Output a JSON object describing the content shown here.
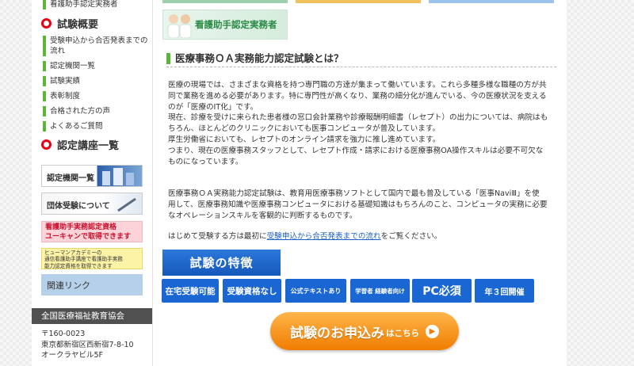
{
  "sidebar": {
    "top_item": "看護助手認定実務者",
    "exam_overview": {
      "title": "試験概要",
      "items": [
        "受験申込から合否発表までの流れ",
        "認定機関一覧",
        "試験実績",
        "表彰制度",
        "合格された方の声",
        "よくあるご質問"
      ]
    },
    "course_list": {
      "title": "認定講座一覧"
    },
    "banners": {
      "accredited": "認定機関一覧",
      "group": "団体受験について",
      "nurse_aide_line1": "看護助手実務認定資格",
      "nurse_aide_line2": "ユーキャンで取得できます",
      "human_line1": "ヒューマンアカデミーの",
      "human_line2": "通信看護助手講座で看護助手実務",
      "human_line3": "能力認定資格を取得できます",
      "related": "関連リンク"
    },
    "org": {
      "name": "全国医療福祉教育協会",
      "postal": "〒160-0023",
      "address1": "東京都新宿区西新宿7-8-10",
      "address2": "オークラヤビル5F"
    }
  },
  "main": {
    "top_banner": "看護助手認定実務者",
    "heading": "医療事務ＯＡ実務能力認定試験とは？",
    "para1": [
      "医療の現場では、さまざまな資格を持つ専門職の方達が集まって働いています。これら多種多様な職種の方が共",
      "同で業務を進める必要があります。特に専門性が高くなり、業務の細分化が進んでいる、今の医療状況を支える",
      "のが「医療のIT化」です。",
      "現在、診療を受けに来られた患者様の窓口会計業務や診療報酬明細書（レセプト）の出力については、病院はも",
      "ちろん、ほとんどのクリニックにおいても医事コンピュータが普及しています。",
      "厚生労働省においても、レセプトのオンライン請求を強力に推し進めています。",
      "つまり、現在の医療事務スタッフとして、レセプト作成・請求における医療事務OA操作スキルは必要不可欠な",
      "ものになっています。"
    ],
    "para2": [
      "医療事務ＯＡ実務能力認定試験は、教育用医療事務ソフトとして国内で最も普及している「医事NaviⅢ」を使",
      "用して、医療事務知識や医療事務コンピュータにおける基礎知識はもちろんのこと、コンピュータの実務に必要",
      "なオペレーションスキルを客観的に判断するものです。"
    ],
    "para3_before": "はじめて受験する方は最初に",
    "para3_link": "受験申込から合否発表までの流れ",
    "para3_after": "をご覧ください。",
    "features_title": "試験の特徴",
    "features": [
      "在宅受験可能",
      "受験資格なし",
      "公式テキストあり",
      "学習者 経験者向け",
      "PC必須",
      "年３回開催"
    ],
    "apply_main": "試験のお申込み",
    "apply_suffix": "はこちら"
  }
}
